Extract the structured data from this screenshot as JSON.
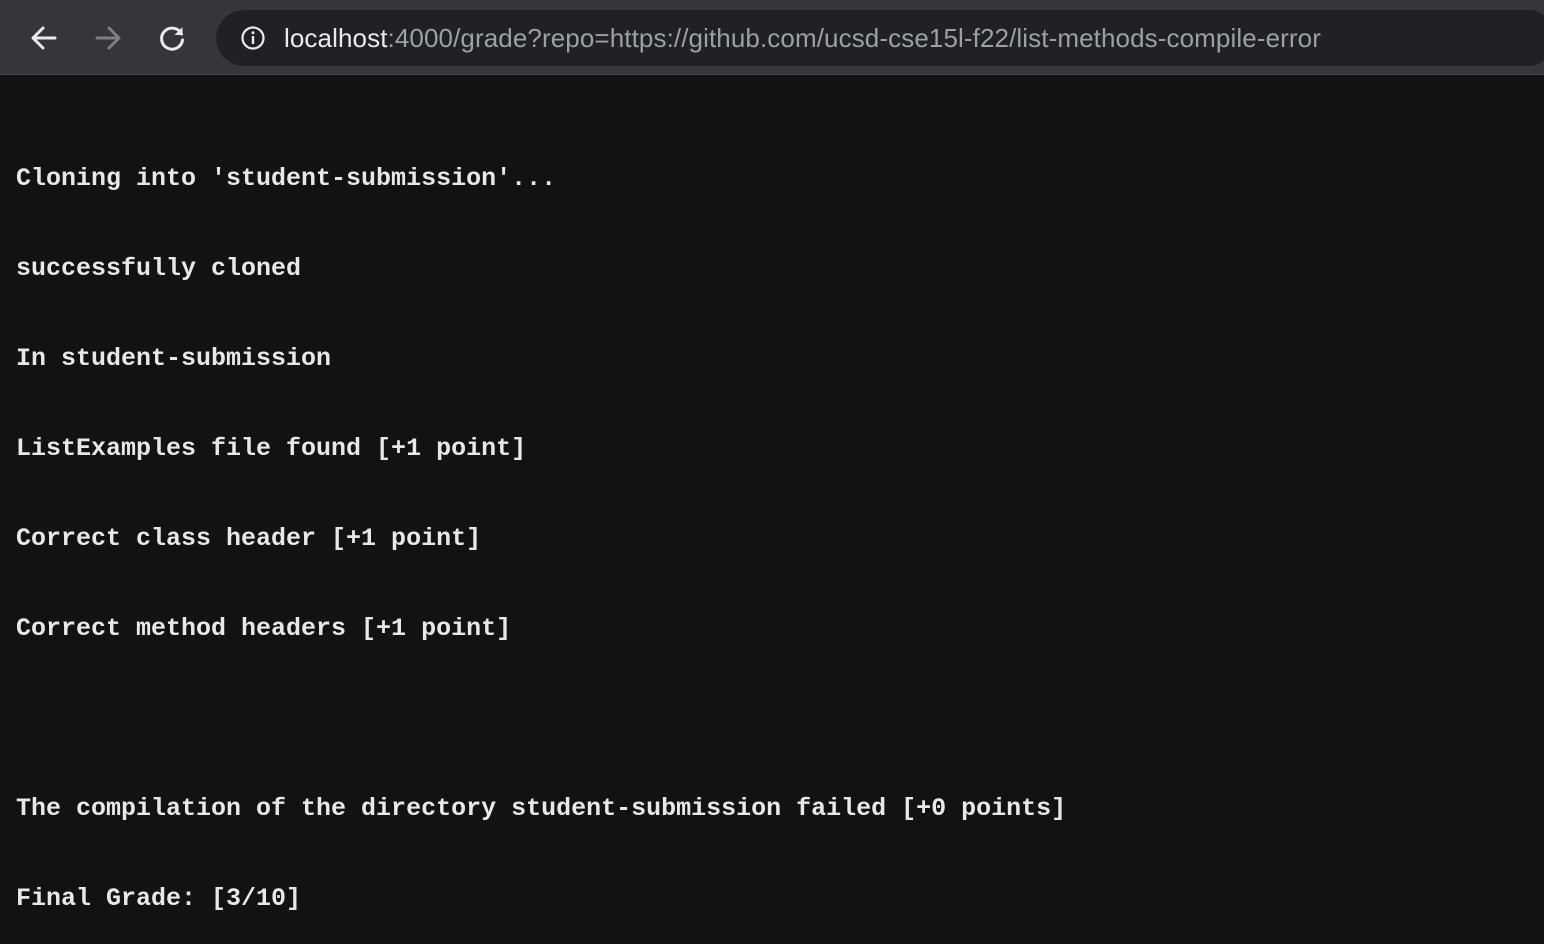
{
  "browser": {
    "address_bar": {
      "host": "localhost",
      "rest": ":4000/grade?repo=https://github.com/ucsd-cse15l-f22/list-methods-compile-error"
    },
    "icons": {
      "back": "arrow-left-icon",
      "forward": "arrow-right-icon",
      "reload": "reload-icon",
      "site_info": "info-icon"
    }
  },
  "page": {
    "lines": [
      "Cloning into 'student-submission'...",
      "successfully cloned",
      "In student-submission",
      "ListExamples file found [+1 point]",
      "Correct class header [+1 point]",
      "Correct method headers [+1 point]",
      "",
      "The compilation of the directory student-submission failed [+0 points]",
      "Final Grade: [3/10]"
    ]
  },
  "colors": {
    "toolbar": "#35363a",
    "omnibox": "#202124",
    "page_background": "#121212",
    "text": "#e8e8e8"
  }
}
